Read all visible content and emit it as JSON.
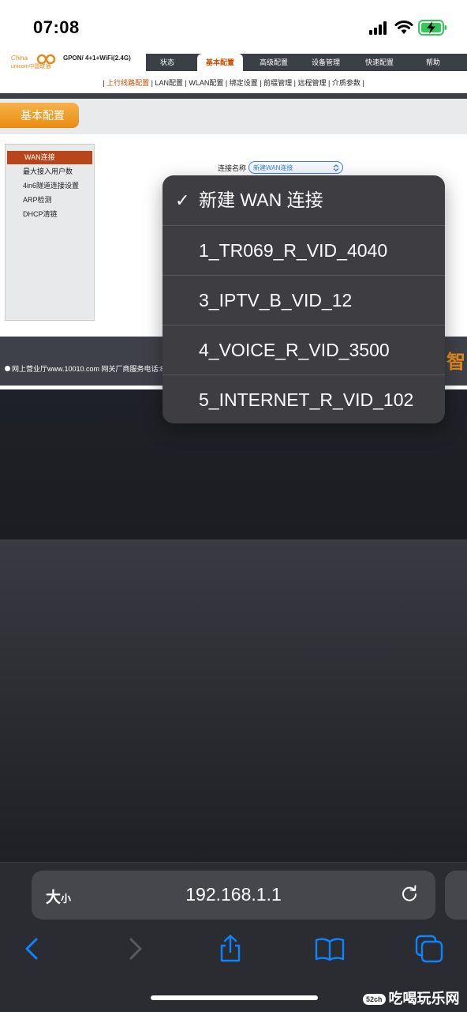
{
  "status_bar": {
    "time": "07:08"
  },
  "router": {
    "logo_text_1": "China",
    "logo_text_2": "unicom中国联通",
    "model": "GPON/ 4+1+WiFi(2.4G)",
    "tabs": [
      "状态",
      "基本配置",
      "高级配置",
      "设备管理",
      "快速配置",
      "帮助"
    ],
    "active_tab": "基本配置",
    "subnav": [
      "上行线路配置",
      "LAN配置",
      "WLAN配置",
      "绑定设置",
      "前缀管理",
      "远程管理",
      "介质参数"
    ],
    "section_title": "基本配置",
    "side_menu": [
      "WAN连接",
      "最大接入用户数",
      "4in6隧道连接设置",
      "ARP检测",
      "DHCP清链"
    ],
    "connection_label": "连接名称",
    "connection_select_value": "新建WAN连接",
    "footer_text": "网上营业厅www.10010.com 网关厂商服务电话:80",
    "footer_brand": "智"
  },
  "dropdown": {
    "options": [
      {
        "label": "新建 WAN 连接",
        "selected": true
      },
      {
        "label": "1_TR069_R_VID_4040",
        "selected": false
      },
      {
        "label": "3_IPTV_B_VID_12",
        "selected": false
      },
      {
        "label": "4_VOICE_R_VID_3500",
        "selected": false
      },
      {
        "label": "5_INTERNET_R_VID_102",
        "selected": false
      }
    ]
  },
  "browser": {
    "text_size_big": "大",
    "text_size_small": "小",
    "url": "192.168.1.1"
  },
  "watermark": {
    "badge": "52ch",
    "text": "吃喝玩乐网"
  },
  "colors": {
    "accent": "#c94c00",
    "ios_blue": "#0a84ff",
    "battery_green": "#34c759"
  }
}
